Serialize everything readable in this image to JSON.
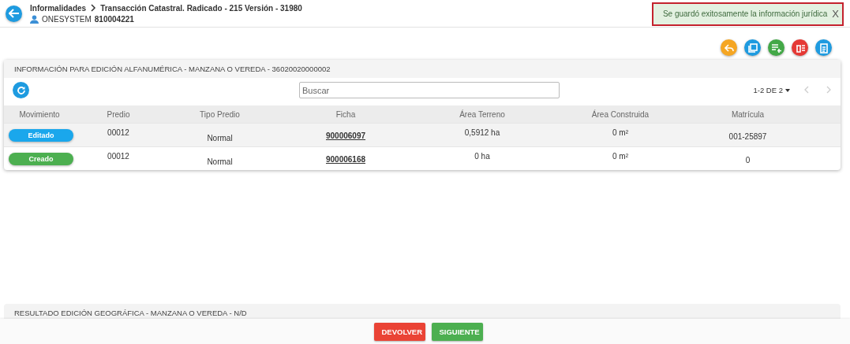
{
  "header": {
    "breadcrumb": [
      "Informalidades",
      "Transacción Catastral. Radicado - 215 Versión - 31980"
    ],
    "user_label": "ONESYSTEM",
    "user_id": "810004221"
  },
  "toast": {
    "message": "Se guardó exitosamente la información jurídica",
    "close": "X"
  },
  "actions": [
    {
      "kind": "reply",
      "color": "#f5a623"
    },
    {
      "kind": "copy",
      "color": "#1e9be0"
    },
    {
      "kind": "add-list",
      "color": "#43a847"
    },
    {
      "kind": "delete-list",
      "color": "#e53935"
    },
    {
      "kind": "clipboard",
      "color": "#1e9be0"
    }
  ],
  "panel": {
    "title": "INFORMACIÓN PARA EDICIÓN ALFANUMÉRICA - MANZANA O VEREDA - 36020020000002",
    "search": {
      "placeholder": "Buscar"
    },
    "pagination": "1-2 DE 2",
    "table": {
      "columns": [
        "Movimiento",
        "Predio",
        "Tipo Predio",
        "Ficha",
        "Área Terreno",
        "Área Construida",
        "Matrícula"
      ],
      "rows": [
        {
          "movement": "Editado",
          "color": "#1aa7ec",
          "predio": "00012",
          "tipo": "Normal",
          "ficha": "900006097",
          "area_terreno": "0,5912 ha",
          "area_construida": "0 m²",
          "matricula": "001-25897"
        },
        {
          "movement": "Creado",
          "color": "#4caf50",
          "predio": "00012",
          "tipo": "Normal",
          "ficha": "900006168",
          "area_terreno": "0 ha",
          "area_construida": "0 m²",
          "matricula": "0"
        }
      ]
    }
  },
  "panel_2": {
    "title": "RESULTADO EDICIÓN GEOGRÁFICA - MANZANA O VEREDA - N/D"
  },
  "footer": {
    "buttons": [
      {
        "label": "DEVOLVER",
        "kind": "danger"
      },
      {
        "label": "SIGUIENTE",
        "kind": "success"
      }
    ]
  }
}
